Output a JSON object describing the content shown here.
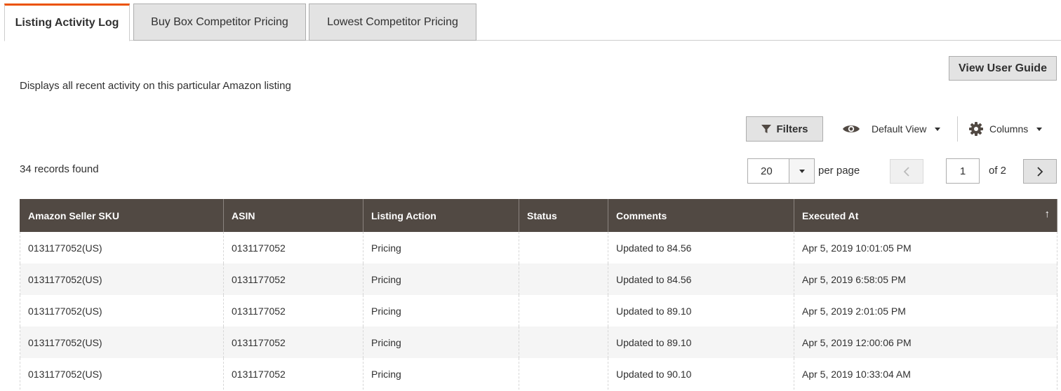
{
  "tabs": [
    {
      "label": "Listing Activity Log",
      "active": true
    },
    {
      "label": "Buy Box Competitor Pricing",
      "active": false
    },
    {
      "label": "Lowest Competitor Pricing",
      "active": false
    }
  ],
  "accent_color": "#eb5202",
  "header_color": "#514943",
  "guide_button": "View User Guide",
  "description": "Displays all recent activity on this particular Amazon listing",
  "toolbar": {
    "filters_label": "Filters",
    "filters_icon": "funnel-icon",
    "view_label": "Default View",
    "view_icon": "eye-icon",
    "columns_label": "Columns",
    "columns_icon": "gear-icon"
  },
  "records_text": "34 records found",
  "pagination": {
    "per_page_value": "20",
    "per_page_label": "per page",
    "current_page": "1",
    "of_text": "of 2"
  },
  "table": {
    "columns": [
      "Amazon Seller SKU",
      "ASIN",
      "Listing Action",
      "Status",
      "Comments",
      "Executed At"
    ],
    "sort_indicator": "↑",
    "rows": [
      {
        "sku": "0131177052(US)",
        "asin": "0131177052",
        "action": "Pricing",
        "status": "",
        "comments": "Updated to 84.56",
        "executed": "Apr 5, 2019 10:01:05 PM"
      },
      {
        "sku": "0131177052(US)",
        "asin": "0131177052",
        "action": "Pricing",
        "status": "",
        "comments": "Updated to 84.56",
        "executed": "Apr 5, 2019 6:58:05 PM"
      },
      {
        "sku": "0131177052(US)",
        "asin": "0131177052",
        "action": "Pricing",
        "status": "",
        "comments": "Updated to 89.10",
        "executed": "Apr 5, 2019 2:01:05 PM"
      },
      {
        "sku": "0131177052(US)",
        "asin": "0131177052",
        "action": "Pricing",
        "status": "",
        "comments": "Updated to 89.10",
        "executed": "Apr 5, 2019 12:00:06 PM"
      },
      {
        "sku": "0131177052(US)",
        "asin": "0131177052",
        "action": "Pricing",
        "status": "",
        "comments": "Updated to 90.10",
        "executed": "Apr 5, 2019 10:33:04 AM"
      }
    ]
  }
}
